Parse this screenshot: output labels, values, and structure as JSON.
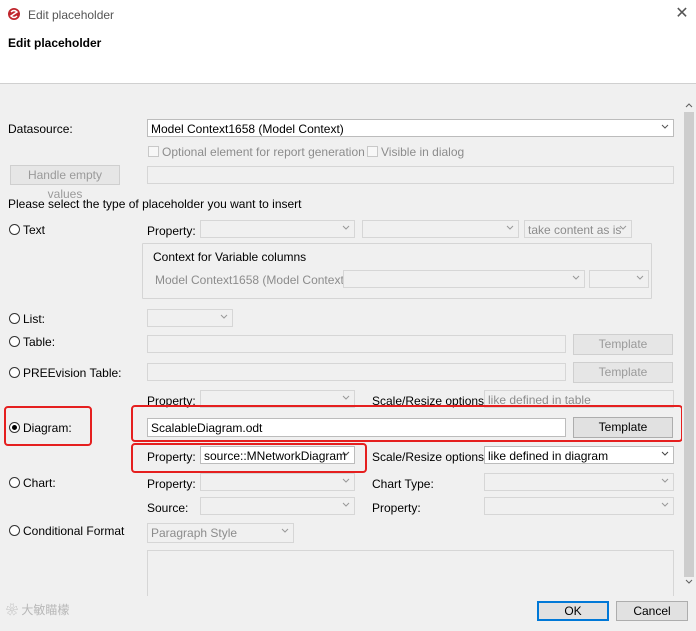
{
  "window": {
    "title": "Edit placeholder",
    "close_glyph": "✕"
  },
  "header": {
    "title": "Edit placeholder"
  },
  "datasource": {
    "label": "Datasource:",
    "value": "Model Context1658 (Model Context)"
  },
  "options": {
    "optional_label": "Optional element for report generation",
    "visible_label": "Visible in dialog"
  },
  "handle_empty": {
    "label": "Handle empty values"
  },
  "instruction": "Please select the type of placeholder you want to insert",
  "text_row": {
    "radio_label": "Text",
    "property_label": "Property:",
    "content_mode": "take content as is",
    "context_group_title": "Context for Variable columns",
    "context_value": "Model Context1658 (Model Context)"
  },
  "list_row": {
    "radio_label": "List:"
  },
  "table_row": {
    "radio_label": "Table:",
    "template_label": "Template"
  },
  "preevision_row": {
    "radio_label": "PREEvision Table:",
    "template_label": "Template"
  },
  "upper_prop_row": {
    "property_label": "Property:",
    "scale_label": "Scale/Resize options:",
    "scale_value": "like defined in table"
  },
  "diagram_row": {
    "radio_label": "Diagram:",
    "file_value": "ScalableDiagram.odt",
    "template_label": "Template",
    "property_label": "Property:",
    "property_value": "source::MNetworkDiagram",
    "scale_label": "Scale/Resize options:",
    "scale_value": "like defined in diagram"
  },
  "chart_row": {
    "radio_label": "Chart:",
    "property_label": "Property:",
    "chart_type_label": "Chart Type:",
    "source_label": "Source:",
    "property2_label": "Property:"
  },
  "conditional_row": {
    "radio_label": "Conditional Format",
    "style_value": "Paragraph Style"
  },
  "footer": {
    "ok_label": "OK",
    "cancel_label": "Cancel"
  },
  "watermark": "大敏瞄檬",
  "colors": {
    "highlight": "#e51f1f",
    "default_button_border": "#0078d7"
  },
  "selected_type": "Diagram"
}
